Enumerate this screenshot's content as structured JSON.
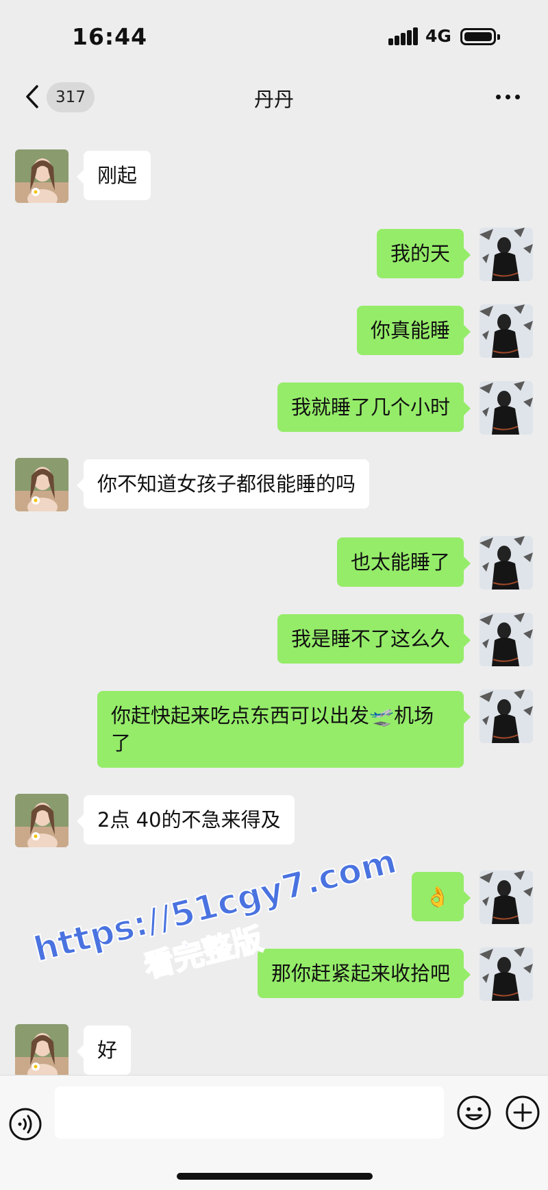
{
  "status_bar": {
    "time": "16:44",
    "network": "4G"
  },
  "nav": {
    "back_badge": "317",
    "title": "丹丹"
  },
  "messages": [
    {
      "dir": "in",
      "text": "刚起"
    },
    {
      "dir": "out",
      "text": "我的天"
    },
    {
      "dir": "out",
      "text": "你真能睡"
    },
    {
      "dir": "out",
      "text": "我就睡了几个小时"
    },
    {
      "dir": "in",
      "text": "你不知道女孩子都很能睡的吗"
    },
    {
      "dir": "out",
      "text": "也太能睡了"
    },
    {
      "dir": "out",
      "text": "我是睡不了这么久"
    },
    {
      "dir": "out",
      "text": "你赶快起来吃点东西可以出发🛫机场了"
    },
    {
      "dir": "in",
      "text": "2点 40的不急来得及"
    },
    {
      "dir": "out",
      "text": "👌"
    },
    {
      "dir": "out",
      "text": "那你赶紧起来收拾吧"
    },
    {
      "dir": "in",
      "text": "好"
    }
  ],
  "watermark": {
    "url": "https://51cgy7.com",
    "caption": "看完整版"
  },
  "input": {
    "value": ""
  },
  "colors": {
    "background": "#ededed",
    "incoming_bubble": "#ffffff",
    "outgoing_bubble": "#95ec69",
    "watermark": "#4a73e0"
  },
  "icons": {
    "back": "chevron-left-icon",
    "more": "more-dots-icon",
    "voice": "voice-icon",
    "emoji": "emoji-icon",
    "plus": "plus-icon"
  }
}
